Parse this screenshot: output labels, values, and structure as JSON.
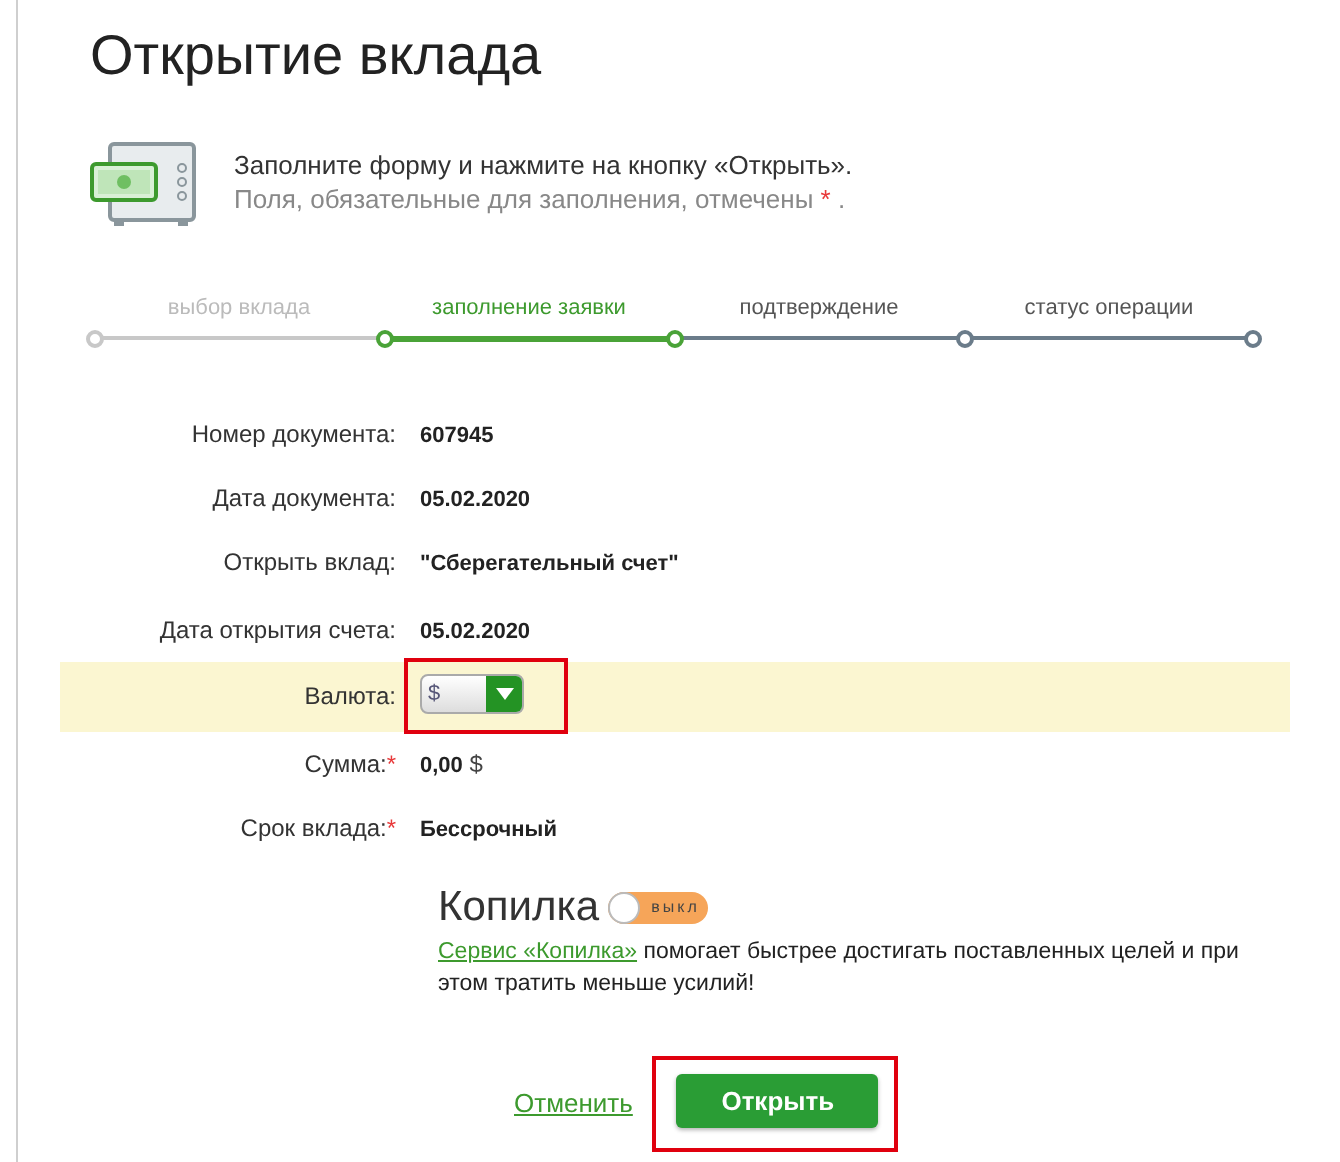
{
  "title": "Открытие вклада",
  "intro": {
    "instruction": "Заполните форму и нажмите на кнопку «Открыть».",
    "hint": "Поля, обязательные для заполнения, отмечены",
    "hint_mark": "*",
    "hint_end": "."
  },
  "steps": [
    {
      "label": "выбор вклада",
      "completed": true,
      "selected": false
    },
    {
      "label": "заполнение заявки",
      "completed": false,
      "selected": true
    },
    {
      "label": "подтверждение",
      "completed": false,
      "selected": false
    },
    {
      "label": "статус операции",
      "completed": false,
      "selected": false
    }
  ],
  "fields": [
    {
      "kind": "text",
      "label": "Номер документа:",
      "value": "607945"
    },
    {
      "kind": "text",
      "label": "Дата документа:",
      "value": "05.02.2020"
    },
    {
      "kind": "text",
      "label": "Открыть вклад:",
      "value": "\"Сберегательный счет\""
    },
    {
      "kind": "text",
      "label": "Дата открытия счета:",
      "value": "05.02.2020"
    },
    {
      "kind": "select",
      "label": "Валюта:",
      "value": "$",
      "highlighted": true
    },
    {
      "kind": "amount",
      "label": "Сумма:",
      "value": "0,00",
      "unit": "$",
      "required_mark": "*"
    },
    {
      "kind": "text",
      "label": "Срок вклада:",
      "value": "Бессрочный",
      "required_mark": "*"
    }
  ],
  "piggy": {
    "title": "Копилка",
    "on": false,
    "toggle_label": "выкл",
    "link": "Сервис «Копилка»",
    "text": "помогает быстрее достигать поставленных целей и при этом тратить меньше усилий!"
  },
  "actions": {
    "cancel": "Отменить",
    "submit": "Открыть",
    "submit_highlighted": true
  }
}
